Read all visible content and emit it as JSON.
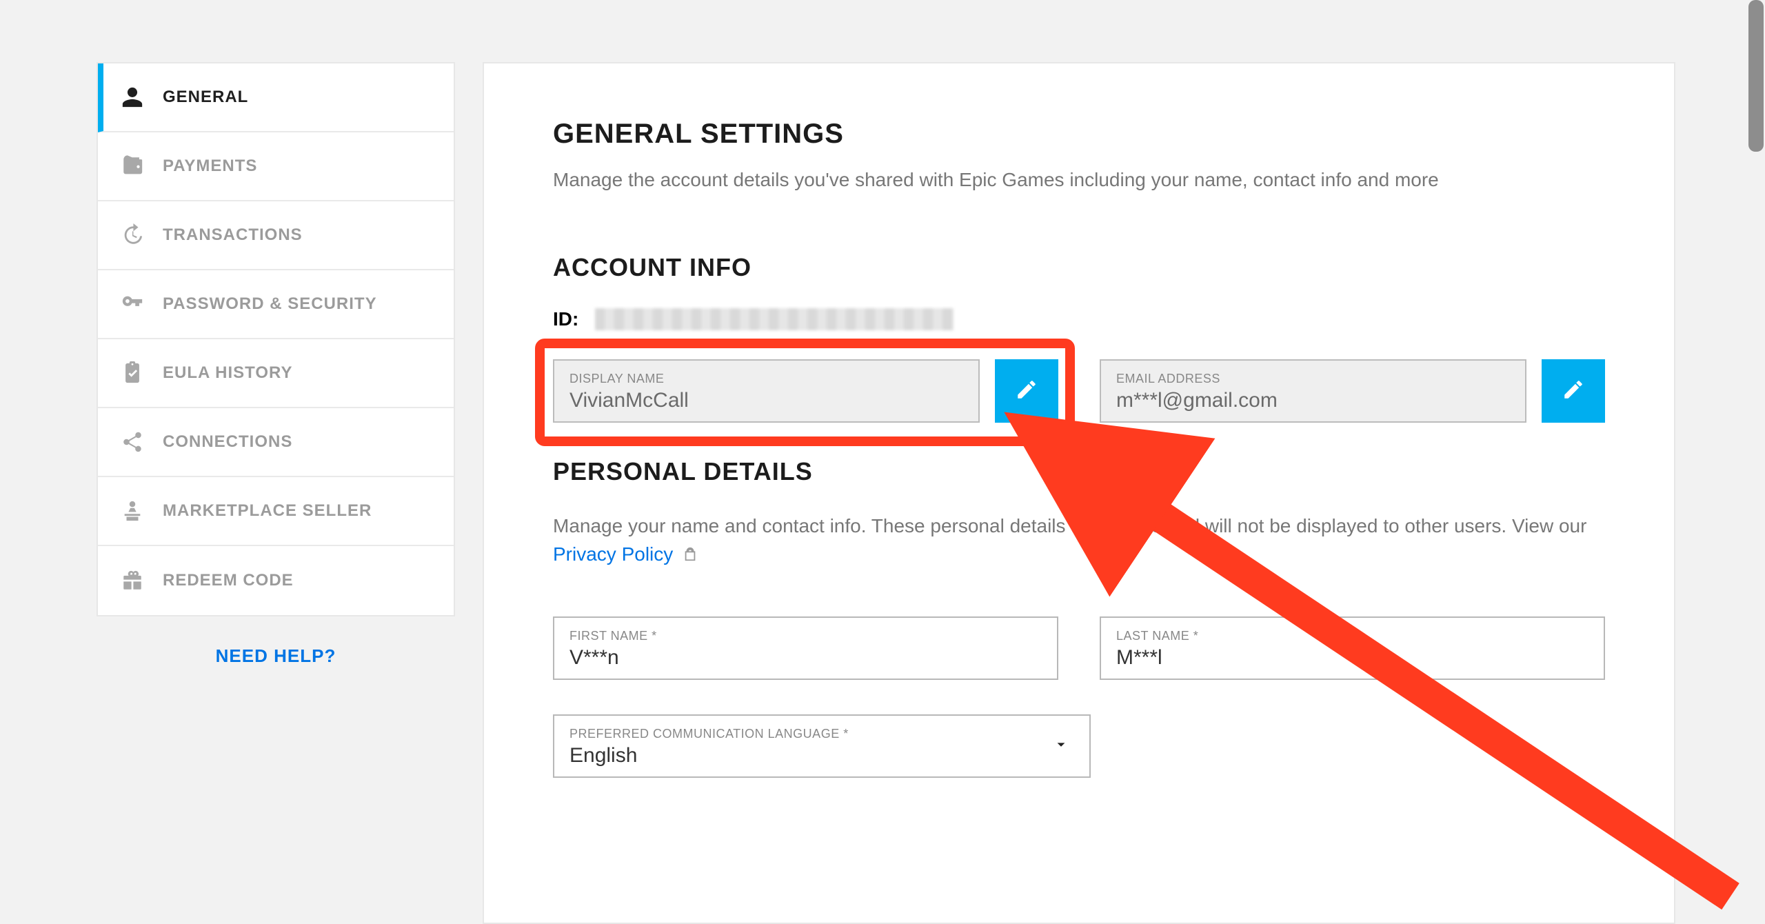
{
  "sidebar": {
    "items": [
      {
        "label": "GENERAL"
      },
      {
        "label": "PAYMENTS"
      },
      {
        "label": "TRANSACTIONS"
      },
      {
        "label": "PASSWORD & SECURITY"
      },
      {
        "label": "EULA HISTORY"
      },
      {
        "label": "CONNECTIONS"
      },
      {
        "label": "MARKETPLACE SELLER"
      },
      {
        "label": "REDEEM CODE"
      }
    ],
    "help": "NEED HELP?"
  },
  "main": {
    "title": "GENERAL SETTINGS",
    "subtitle": "Manage the account details you've shared with Epic Games including your name, contact info and more",
    "account_info_title": "ACCOUNT INFO",
    "id_label": "ID:",
    "display_name": {
      "label": "DISPLAY NAME",
      "value": "VivianMcCall"
    },
    "email": {
      "label": "EMAIL ADDRESS",
      "value": "m***l@gmail.com"
    },
    "personal_title": "PERSONAL DETAILS",
    "personal_desc_1": "Manage your name and contact info. These personal details are private and will not be displayed to other users. View our ",
    "privacy_link": "Privacy Policy",
    "first_name": {
      "label": "FIRST NAME *",
      "value": "V***n"
    },
    "last_name": {
      "label": "LAST NAME *",
      "value": "M***l"
    },
    "language": {
      "label": "PREFERRED COMMUNICATION LANGUAGE *",
      "value": "English"
    }
  },
  "colors": {
    "accent": "#00aeef",
    "link": "#0074e4",
    "annotation": "#ff3b1f"
  }
}
